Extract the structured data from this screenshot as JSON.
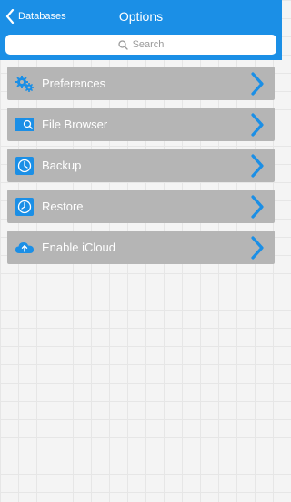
{
  "header": {
    "back_label": "Databases",
    "title": "Options"
  },
  "search": {
    "placeholder": "Search"
  },
  "menu": {
    "items": [
      {
        "label": "Preferences",
        "icon": "gears-icon"
      },
      {
        "label": "File Browser",
        "icon": "file-browser-icon"
      },
      {
        "label": "Backup",
        "icon": "backup-clock-icon"
      },
      {
        "label": "Restore",
        "icon": "restore-clock-icon"
      },
      {
        "label": "Enable iCloud",
        "icon": "icloud-upload-icon"
      }
    ]
  },
  "colors": {
    "header_bg": "#1b8fe6",
    "item_bg": "#b5b5b5",
    "icon_blue": "#1b8fe6"
  }
}
